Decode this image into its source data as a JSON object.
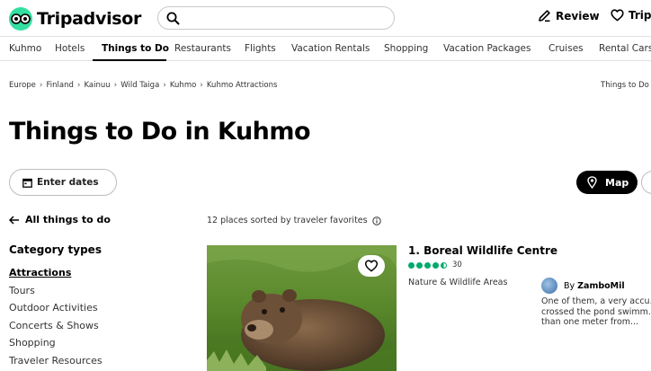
{
  "header": {
    "brand": "Tripadvisor",
    "search_placeholder": "",
    "review_label": "Review",
    "trips_label": "Trips"
  },
  "nav": {
    "items": [
      "Kuhmo",
      "Hotels",
      "Things to Do",
      "Restaurants",
      "Flights",
      "Vacation Rentals",
      "Shopping",
      "Vacation Packages",
      "Cruises",
      "Rental Cars"
    ],
    "active_index": 2
  },
  "breadcrumb": {
    "items": [
      "Europe",
      "Finland",
      "Kainuu",
      "Wild Taiga",
      "Kuhmo",
      "Kuhmo Attractions"
    ],
    "right_text": "Things to Do in"
  },
  "page": {
    "title": "Things to Do in Kuhmo",
    "dates_label": "Enter dates",
    "map_label": "Map"
  },
  "sidebar": {
    "back_label": "All things to do",
    "heading": "Category types",
    "items": [
      "Attractions",
      "Tours",
      "Outdoor Activities",
      "Concerts & Shows",
      "Shopping",
      "Traveler Resources"
    ],
    "selected_index": 0
  },
  "results": {
    "sort_text": "12 places sorted by traveler favorites",
    "card": {
      "title": "1. Boreal Wildlife Centre",
      "rating": 4.5,
      "review_count": "30",
      "category": "Nature & Wildlife Areas",
      "review_by": "By",
      "reviewer": "ZamboMil",
      "review_text": "One of them, a very accu... crossed the pond swimm... than one meter from..."
    }
  },
  "colors": {
    "brand_green": "#34e0a1",
    "rating_green": "#00aa6c",
    "map_button_bg": "#000000"
  },
  "icons": {
    "logo": "owl-eyes-icon",
    "search": "search-icon",
    "review": "pencil-icon",
    "trips": "heart-icon",
    "dates": "calendar-icon",
    "map": "map-pin-icon",
    "back": "arrow-left-icon",
    "info": "info-icon",
    "favorite": "heart-outline-icon"
  }
}
